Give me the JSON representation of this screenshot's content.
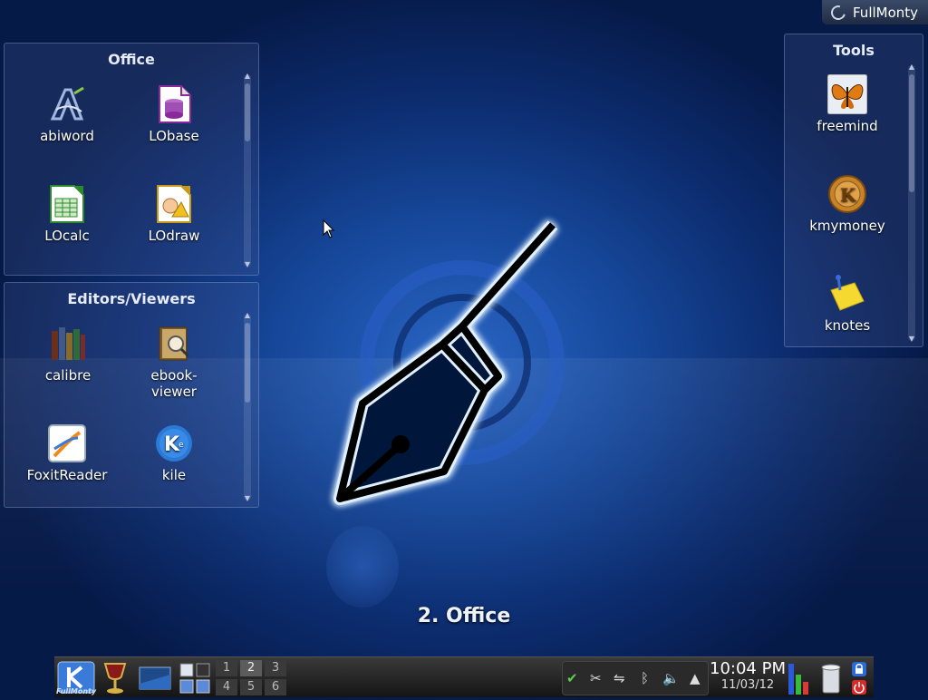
{
  "activity_button": {
    "label": "FullMonty"
  },
  "office": {
    "title": "Office",
    "items": [
      {
        "label": "abiword"
      },
      {
        "label": "LObase"
      },
      {
        "label": "LOcalc"
      },
      {
        "label": "LOdraw"
      }
    ]
  },
  "editors": {
    "title": "Editors/Viewers",
    "items": [
      {
        "label": "calibre"
      },
      {
        "label": "ebook-\nviewer"
      },
      {
        "label": "FoxitReader"
      },
      {
        "label": "kile"
      }
    ]
  },
  "tools": {
    "title": "Tools",
    "items": [
      {
        "label": "freemind"
      },
      {
        "label": "kmymoney"
      },
      {
        "label": "knotes"
      }
    ]
  },
  "desktop": {
    "activity_name": "2. Office"
  },
  "panel": {
    "kmenu_label": "FullMonty",
    "desktops": [
      "1",
      "2",
      "3",
      "4",
      "5",
      "6"
    ],
    "active_desktop": "2",
    "clock_time": "10:04 PM",
    "clock_date": "11/03/12"
  },
  "colors": {
    "accent": "#1c5bd0",
    "panel": "#1c1c1c",
    "widget_bg": "#33406a"
  },
  "icons": {
    "abiword": "abiword-icon",
    "lobase": "libreoffice-base-icon",
    "localc": "libreoffice-calc-icon",
    "lodraw": "libreoffice-draw-icon",
    "calibre": "calibre-books-icon",
    "ebook": "ebook-viewer-icon",
    "foxit": "foxit-reader-icon",
    "kile": "kile-icon",
    "freemind": "butterfly-icon",
    "kmymoney": "kmymoney-coin-icon",
    "knotes": "sticky-note-icon"
  }
}
